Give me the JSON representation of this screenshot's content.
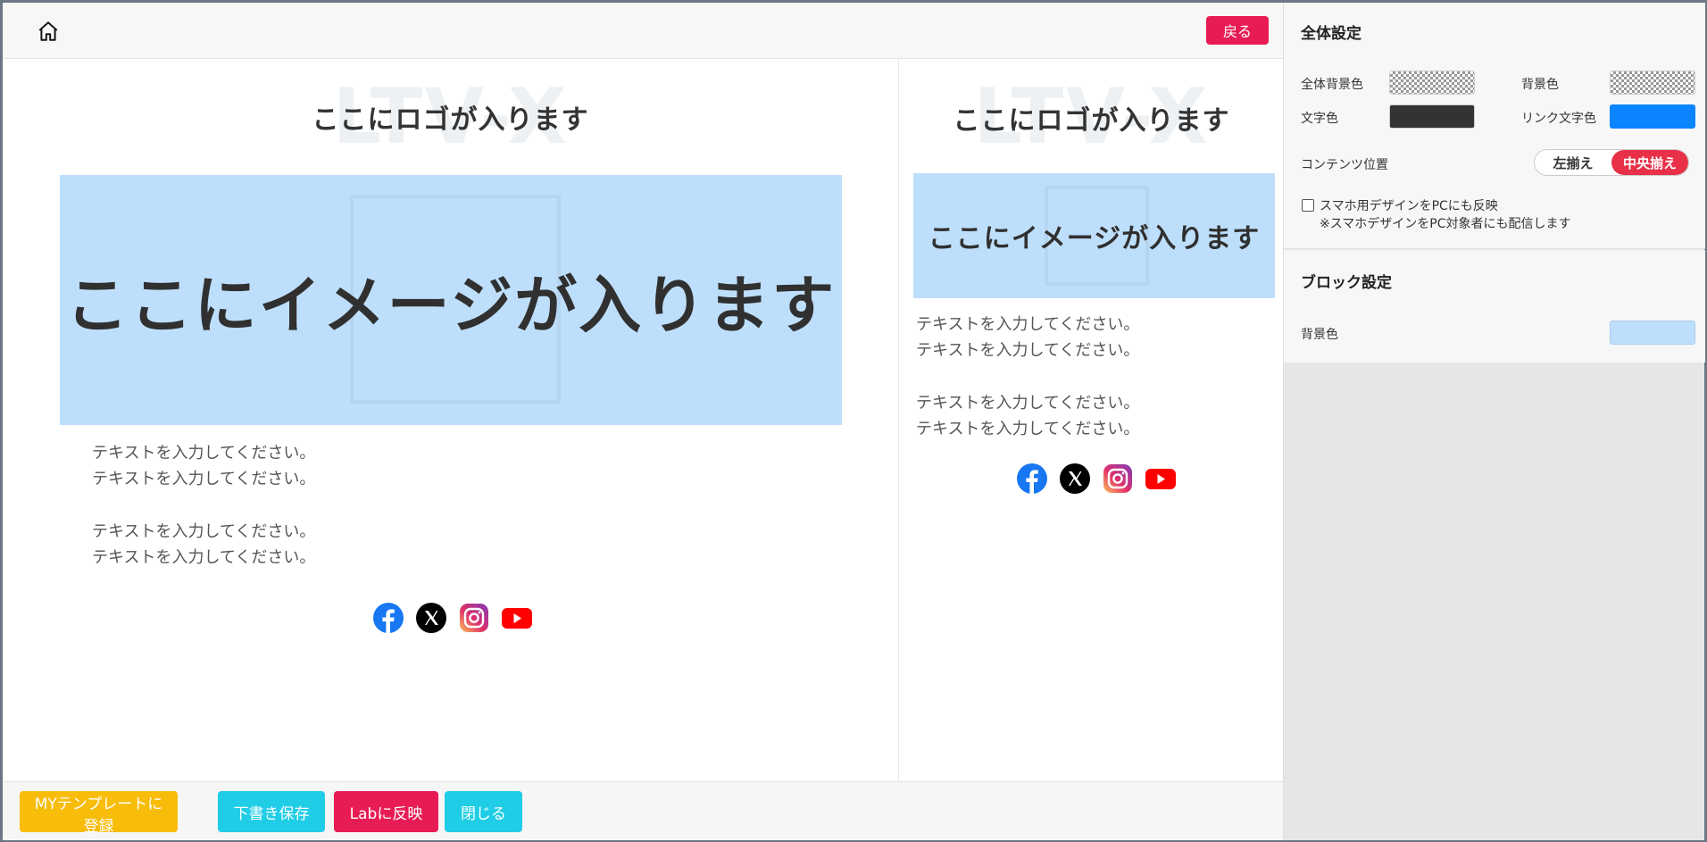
{
  "topbar": {
    "back_label": "戻る"
  },
  "preview": {
    "logo_watermark": "LTV-X",
    "logo_text": "ここにロゴが入ります",
    "image_text": "ここにイメージが入ります",
    "text_lines": [
      "テキストを入力してください。",
      "テキストを入力してください。",
      "テキストを入力してください。",
      "テキストを入力してください。"
    ],
    "social_icons": [
      "facebook-icon",
      "x-icon",
      "instagram-icon",
      "youtube-icon"
    ]
  },
  "bottombar": {
    "my_template": "MYテンプレートに登録",
    "save_draft": "下書き保存",
    "apply_lab": "Labに反映",
    "close": "閉じる"
  },
  "panel": {
    "global": {
      "title": "全体設定",
      "all_bg_label": "全体背景色",
      "bg_label": "背景色",
      "text_color_label": "文字色",
      "link_color_label": "リンク文字色",
      "text_color": "#333333",
      "link_color": "#0a84ff",
      "content_pos_label": "コンテンツ位置",
      "align_left": "左揃え",
      "align_center": "中央揃え",
      "selected_align": "中央揃え",
      "sp_design_label": "スマホ用デザインをPCにも反映",
      "sp_design_note": "※スマホデザインをPC対象者にも配信します"
    },
    "block": {
      "title": "ブロック設定",
      "bg_label": "背景色",
      "bg_color": "#bedffb"
    }
  },
  "colors": {
    "accent_red": "#e81c54",
    "accent_cyan": "#20cde6",
    "accent_yellow": "#f8bc0a"
  }
}
